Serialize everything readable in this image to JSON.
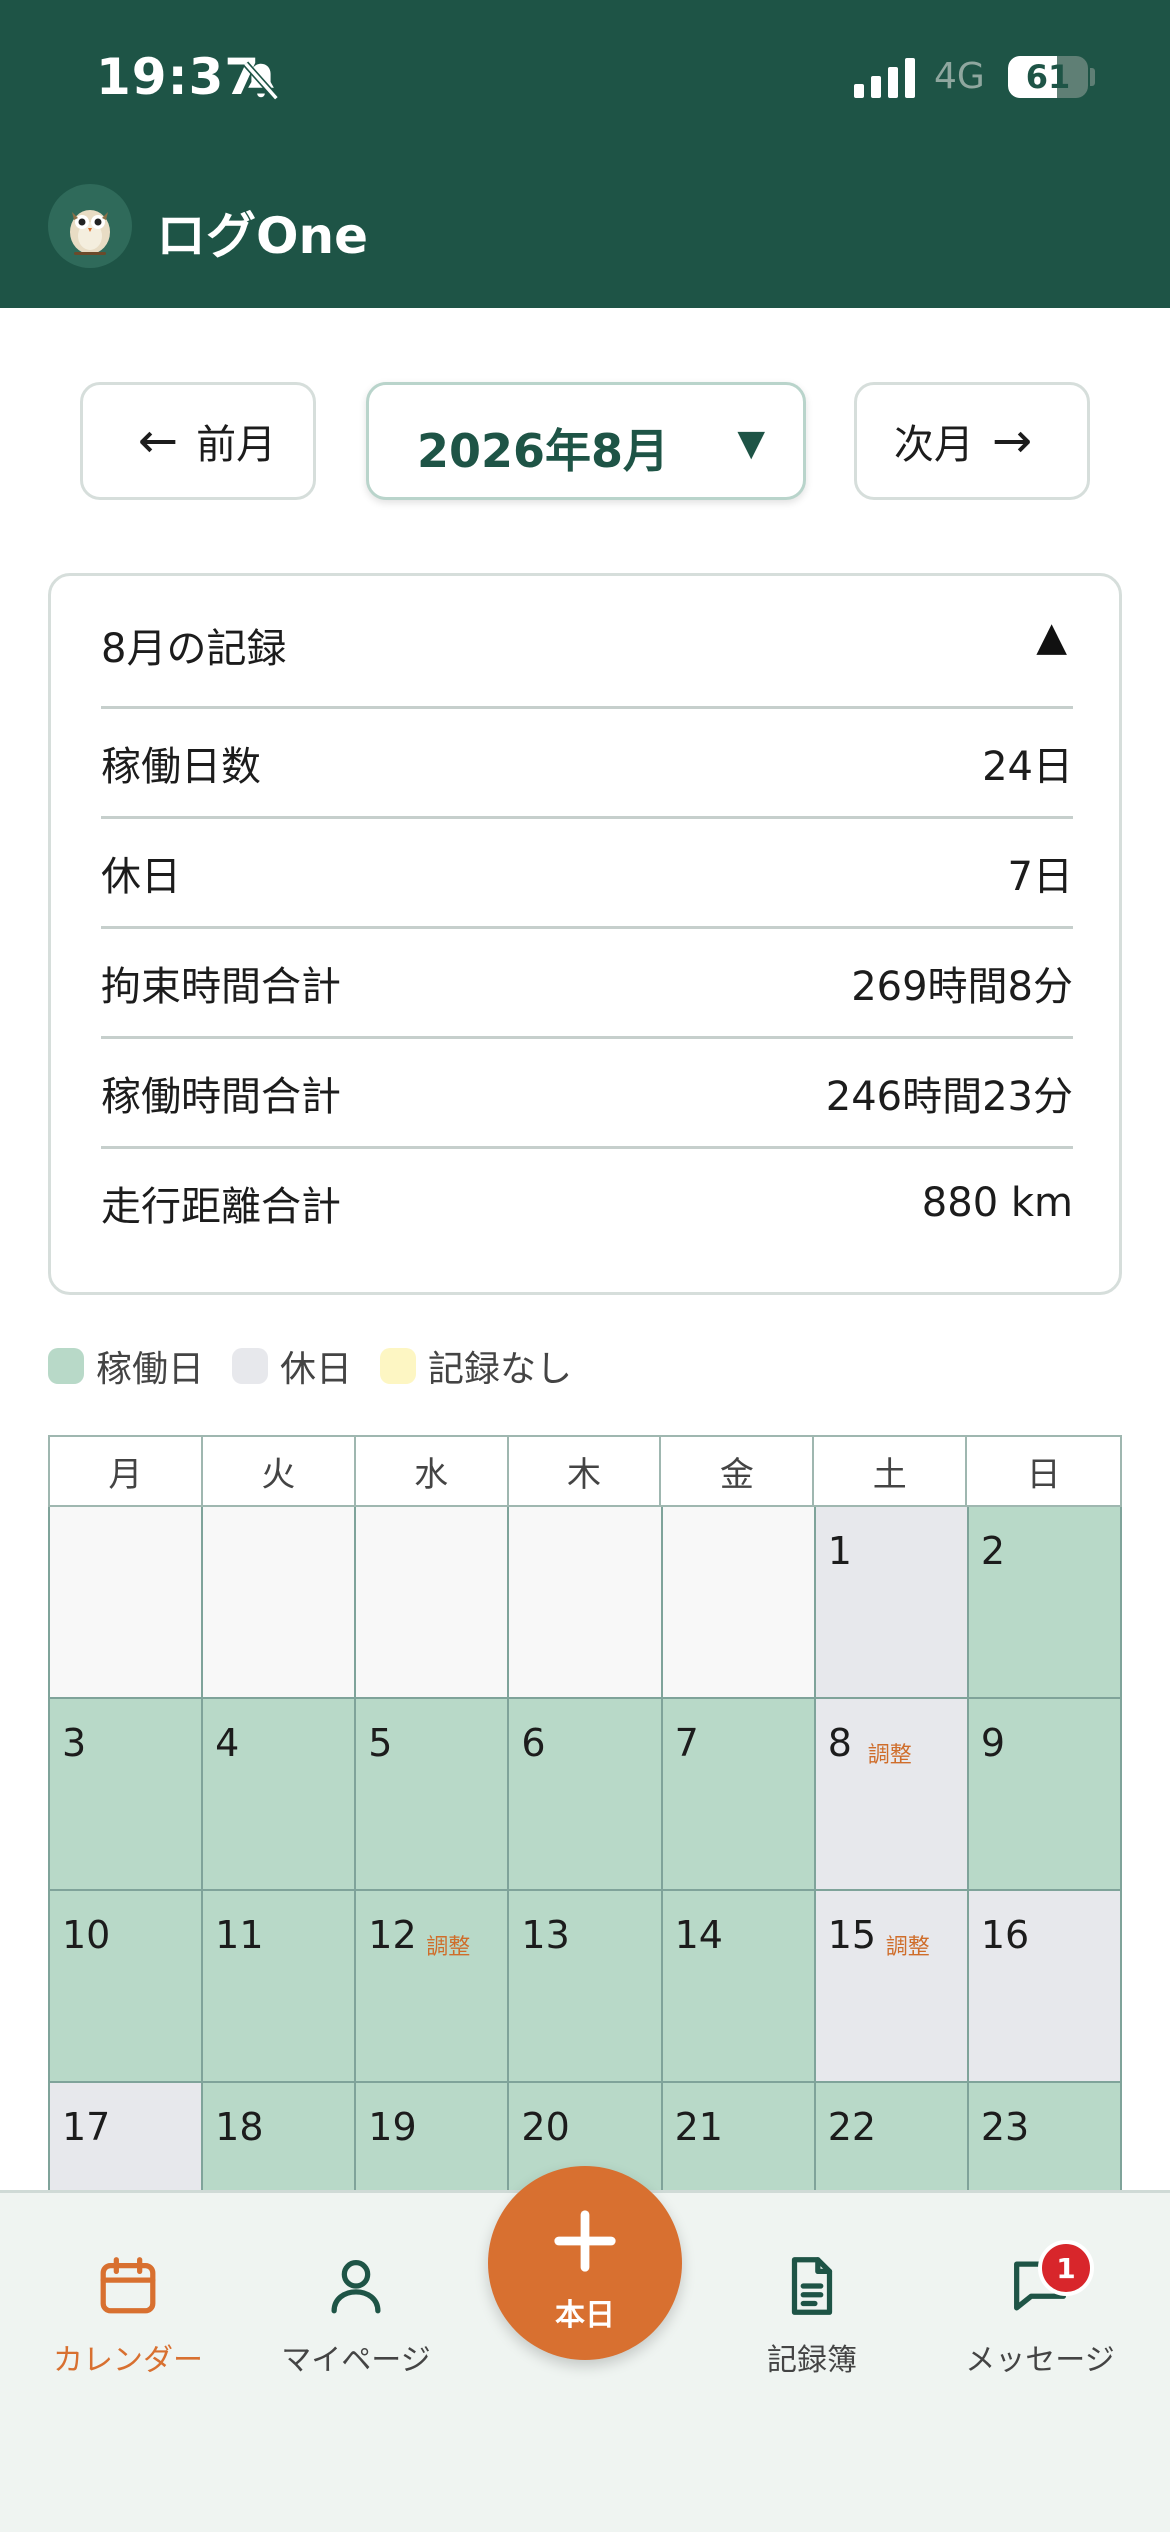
{
  "status_bar": {
    "time": "19:37",
    "network": "4G",
    "battery": "61",
    "battery_level": 0.61
  },
  "header": {
    "title": "ログOne"
  },
  "month_nav": {
    "prev_label": "前月",
    "prev_arrow": "←",
    "current_month": "2026年8月",
    "next_label": "次月",
    "next_arrow": "→",
    "dropdown_caret": "▼"
  },
  "summary": {
    "title": "8月の記録",
    "toggle": "▲",
    "rows": [
      {
        "label": "稼働日数",
        "value": "24日"
      },
      {
        "label": "休日",
        "value": "7日"
      },
      {
        "label": "拘束時間合計",
        "value": "269時間8分"
      },
      {
        "label": "稼働時間合計",
        "value": "246時間23分"
      },
      {
        "label": "走行距離合計",
        "value": "880 km"
      }
    ]
  },
  "legend": [
    {
      "label": "稼働日",
      "color": "#b8d9c8"
    },
    {
      "label": "休日",
      "color": "#e7e8ec"
    },
    {
      "label": "記録なし",
      "color": "#fdf6c3"
    }
  ],
  "calendar": {
    "weekdays": [
      "月",
      "火",
      "水",
      "木",
      "金",
      "土",
      "日"
    ],
    "days": [
      {
        "day": "",
        "type": "empty"
      },
      {
        "day": "",
        "type": "empty"
      },
      {
        "day": "",
        "type": "empty"
      },
      {
        "day": "",
        "type": "empty"
      },
      {
        "day": "",
        "type": "empty"
      },
      {
        "day": "1",
        "type": "holiday"
      },
      {
        "day": "2",
        "type": "work"
      },
      {
        "day": "3",
        "type": "work"
      },
      {
        "day": "4",
        "type": "work"
      },
      {
        "day": "5",
        "type": "work"
      },
      {
        "day": "6",
        "type": "work"
      },
      {
        "day": "7",
        "type": "work"
      },
      {
        "day": "8",
        "type": "holiday",
        "tag": "調整"
      },
      {
        "day": "9",
        "type": "work"
      },
      {
        "day": "10",
        "type": "work"
      },
      {
        "day": "11",
        "type": "work"
      },
      {
        "day": "12",
        "type": "work",
        "tag": "調整"
      },
      {
        "day": "13",
        "type": "work"
      },
      {
        "day": "14",
        "type": "work"
      },
      {
        "day": "15",
        "type": "holiday",
        "tag": "調整"
      },
      {
        "day": "16",
        "type": "holiday"
      },
      {
        "day": "17",
        "type": "holiday"
      },
      {
        "day": "18",
        "type": "work"
      },
      {
        "day": "19",
        "type": "work"
      },
      {
        "day": "20",
        "type": "work"
      },
      {
        "day": "21",
        "type": "work"
      },
      {
        "day": "22",
        "type": "work"
      },
      {
        "day": "23",
        "type": "work"
      }
    ]
  },
  "bottom_nav": {
    "items": [
      {
        "label": "カレンダー",
        "icon": "calendar-icon",
        "active": true
      },
      {
        "label": "マイページ",
        "icon": "person-icon",
        "active": false
      },
      {
        "label": "記録簿",
        "icon": "document-icon",
        "active": false
      },
      {
        "label": "メッセージ",
        "icon": "chat-icon",
        "active": false
      }
    ],
    "fab_label": "本日",
    "message_badge": "1"
  }
}
